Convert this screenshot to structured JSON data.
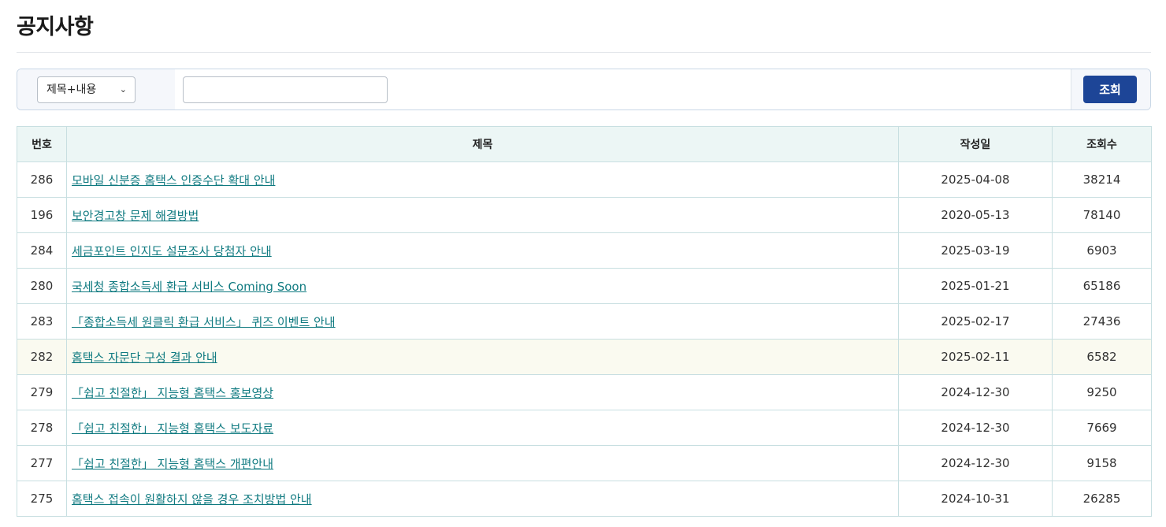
{
  "page": {
    "title": "공지사항"
  },
  "search": {
    "select_value": "제목+내용",
    "keyword_value": "",
    "button_label": "조회"
  },
  "table": {
    "headers": {
      "number": "번호",
      "title": "제목",
      "date": "작성일",
      "views": "조회수"
    },
    "rows": [
      {
        "number": "286",
        "title": "모바일 신분증 홈택스 인증수단 확대 안내",
        "date": "2025-04-08",
        "views": "38214"
      },
      {
        "number": "196",
        "title": "보안경고창 문제 해결방법",
        "date": "2020-05-13",
        "views": "78140"
      },
      {
        "number": "284",
        "title": "세금포인트 인지도 설문조사 당첨자 안내",
        "date": "2025-03-19",
        "views": "6903"
      },
      {
        "number": "280",
        "title": "국세청 종합소득세 환급 서비스 Coming Soon",
        "date": "2025-01-21",
        "views": "65186"
      },
      {
        "number": "283",
        "title": "「종합소득세 원클릭 환급 서비스」 퀴즈 이벤트 안내",
        "date": "2025-02-17",
        "views": "27436"
      },
      {
        "number": "282",
        "title": "홈택스 자문단 구성 결과 안내",
        "date": "2025-02-11",
        "views": "6582"
      },
      {
        "number": "279",
        "title": "「쉽고 친절한」 지능형 홈택스 홍보영상",
        "date": "2024-12-30",
        "views": "9250"
      },
      {
        "number": "278",
        "title": "「쉽고 친절한」 지능형 홈택스 보도자료",
        "date": "2024-12-30",
        "views": "7669"
      },
      {
        "number": "277",
        "title": "「쉽고 친절한」 지능형 홈택스 개편안내",
        "date": "2024-12-30",
        "views": "9158"
      },
      {
        "number": "275",
        "title": "홈택스 접속이 원활하지 않을 경우 조치방법 안내",
        "date": "2024-10-31",
        "views": "26285"
      }
    ]
  },
  "colors": {
    "header_bg": "#ecf6f5",
    "link": "#0f7a80",
    "button": "#1d4597",
    "highlight_row": "#fafaf0"
  }
}
